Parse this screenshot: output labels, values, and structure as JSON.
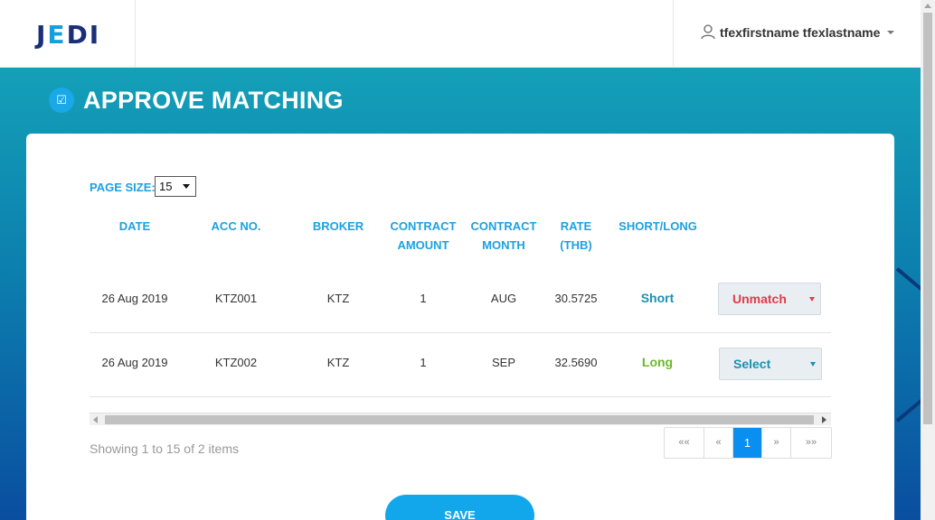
{
  "header": {
    "logo": "JEDI",
    "user_name": "tfexfirstname tfexlastname"
  },
  "page": {
    "title": "APPROVE MATCHING",
    "title_icon": "checkbox-icon"
  },
  "page_size": {
    "label": "PAGE SIZE:",
    "value": "15"
  },
  "table": {
    "headers": {
      "date": "DATE",
      "acc_no": "ACC NO.",
      "broker": "BROKER",
      "contract_amount_1": "CONTRACT",
      "contract_amount_2": "AMOUNT",
      "contract_month_1": "CONTRACT",
      "contract_month_2": "MONTH",
      "rate_1": "RATE",
      "rate_2": "(THB)",
      "short_long": "SHORT/LONG"
    },
    "rows": [
      {
        "date": "26 Aug 2019",
        "acc_no": "KTZ001",
        "broker": "KTZ",
        "contract_amount": "1",
        "contract_month": "AUG",
        "rate": "30.5725",
        "short_long": "Short",
        "action": "Unmatch"
      },
      {
        "date": "26 Aug 2019",
        "acc_no": "KTZ002",
        "broker": "KTZ",
        "contract_amount": "1",
        "contract_month": "SEP",
        "rate": "32.5690",
        "short_long": "Long",
        "action": "Select"
      }
    ]
  },
  "footer": {
    "showing": "Showing 1 to 15 of 2 items"
  },
  "pagination": {
    "first": "««",
    "prev": "«",
    "current": "1",
    "next": "»",
    "last": "»»"
  },
  "actions": {
    "save_label": "SAVE"
  },
  "colors": {
    "accent": "#1ea0e0",
    "short": "#1e8fb0",
    "long": "#6cb82a",
    "unmatch": "#e03c48",
    "active_page": "#0a8ef0"
  }
}
